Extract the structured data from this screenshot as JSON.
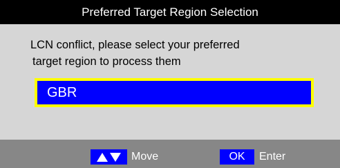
{
  "dialog": {
    "title": "Preferred Target Region Selection",
    "message_line1": "LCN conflict, please select your preferred",
    "message_line2": "target region to process them",
    "selected_region": "GBR"
  },
  "footer": {
    "move_icon": "up-down-arrow-icon",
    "move_label": "Move",
    "ok_key_label": "OK",
    "enter_label": "Enter"
  },
  "colors": {
    "title_bg": "#000000",
    "panel_bg": "#d6d6d6",
    "selection_bg": "#0000ff",
    "selection_border": "#ffff00",
    "footer_bg": "#878787"
  }
}
